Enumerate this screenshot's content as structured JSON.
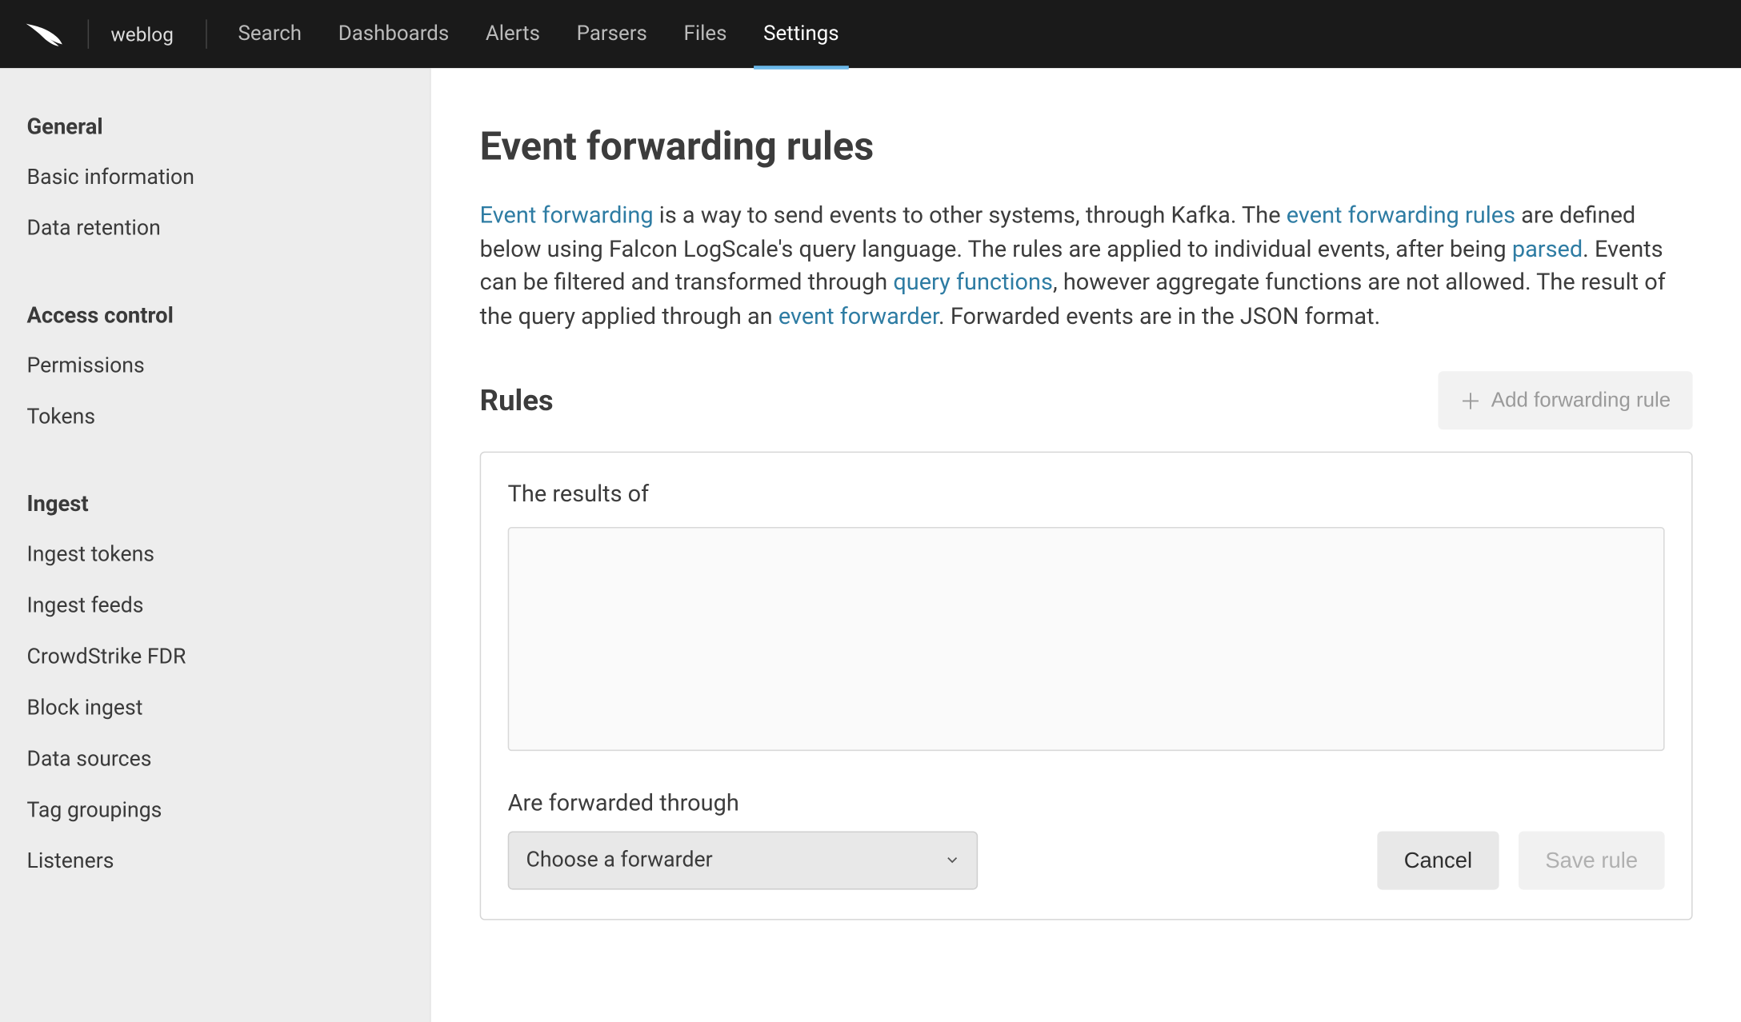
{
  "header": {
    "product": "weblog",
    "nav": [
      "Search",
      "Dashboards",
      "Alerts",
      "Parsers",
      "Files",
      "Settings"
    ],
    "active": "Settings"
  },
  "sidebar": {
    "sections": [
      {
        "title": "General",
        "items": [
          "Basic information",
          "Data retention"
        ]
      },
      {
        "title": "Access control",
        "items": [
          "Permissions",
          "Tokens"
        ]
      },
      {
        "title": "Ingest",
        "items": [
          "Ingest tokens",
          "Ingest feeds",
          "CrowdStrike FDR",
          "Block ingest",
          "Data sources",
          "Tag groupings",
          "Listeners"
        ]
      }
    ]
  },
  "page": {
    "title": "Event forwarding rules",
    "intro": {
      "link_event_forwarding": "Event forwarding",
      "text1": " is a way to send events to other systems, through Kafka. The ",
      "link_rules": "event forwarding rules",
      "text2": " are defined below using Falcon LogScale's query language. The rules are applied to individual events, after being ",
      "link_parsed": "parsed",
      "text3": ". Events can be filtered and transformed through ",
      "link_qf": "query functions",
      "text4": ", however aggregate functions are not allowed. The result of the query applied through an ",
      "link_ef": "event forwarder",
      "text5": ". Forwarded events are in the JSON format."
    },
    "rules_heading": "Rules",
    "add_button": "Add forwarding rule",
    "rule": {
      "results_label": "The results of",
      "forward_label": "Are forwarded through",
      "select_placeholder": "Choose a forwarder",
      "cancel": "Cancel",
      "save": "Save rule"
    }
  }
}
